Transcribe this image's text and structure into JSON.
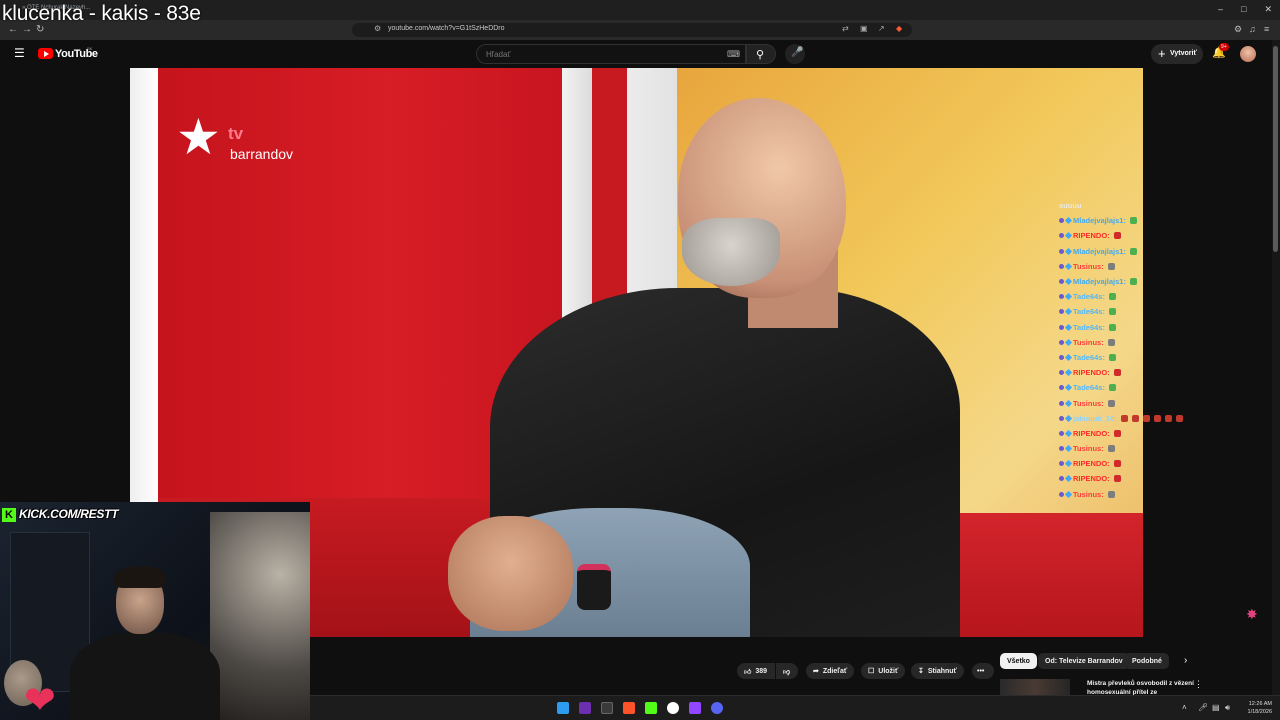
{
  "stream_overlay": {
    "title": "klucenka - kakis - 83e"
  },
  "browser": {
    "tab_title": "» OTE Nchurak Nazevh...",
    "url": "youtube.com/watch?v=G1tSzHeDDro",
    "window_controls": [
      "–",
      "□",
      "✕"
    ]
  },
  "youtube": {
    "logo_text": "YouTube",
    "region": "SK",
    "search_placeholder": "Hľadať",
    "create_label": "Vytvoriť",
    "notification_count": "9+"
  },
  "video": {
    "channel_logo_tv": "tv",
    "channel_logo_name": "barrandov"
  },
  "chat": [
    {
      "user": "xuuuu",
      "color": "#e8e8e8",
      "emote": ""
    },
    {
      "user": "Mladejvajlajs1:",
      "color": "#3fa9f5",
      "emote": "#4caf50"
    },
    {
      "user": "RIPENDO:",
      "color": "#ff2a2a",
      "emote": "#d12a2a"
    },
    {
      "user": "Mladejvajlajs1:",
      "color": "#3fa9f5",
      "emote": "#4caf50"
    },
    {
      "user": "Tusinus:",
      "color": "#ff3b3b",
      "emote": "#7d7d7d"
    },
    {
      "user": "Mladejvajlajs1:",
      "color": "#3fa9f5",
      "emote": "#4caf50"
    },
    {
      "user": "Tade64s:",
      "color": "#4fb8ff",
      "emote": "#4caf50"
    },
    {
      "user": "Tade64s:",
      "color": "#4fb8ff",
      "emote": "#4caf50"
    },
    {
      "user": "Tade64s:",
      "color": "#4fb8ff",
      "emote": "#4caf50"
    },
    {
      "user": "Tusinus:",
      "color": "#ff3b3b",
      "emote": "#7d7d7d"
    },
    {
      "user": "Tade64s:",
      "color": "#4fb8ff",
      "emote": "#4caf50"
    },
    {
      "user": "RIPENDO:",
      "color": "#ff2a2a",
      "emote": "#d12a2a"
    },
    {
      "user": "Tade64s:",
      "color": "#4fb8ff",
      "emote": "#4caf50"
    },
    {
      "user": "Tusinus:",
      "color": "#ff3b3b",
      "emote": "#7d7d7d"
    },
    {
      "user": "jakuuub_10:",
      "color": "#8fd3ff",
      "emote": "#c0392b"
    },
    {
      "user": "RIPENDO:",
      "color": "#ff2a2a",
      "emote": "#d12a2a"
    },
    {
      "user": "Tusinus:",
      "color": "#ff3b3b",
      "emote": "#7d7d7d"
    },
    {
      "user": "RIPENDO:",
      "color": "#ff2a2a",
      "emote": "#d12a2a"
    },
    {
      "user": "RIPENDO:",
      "color": "#ff2a2a",
      "emote": "#d12a2a"
    },
    {
      "user": "Tusinus:",
      "color": "#ff3b3b",
      "emote": "#7d7d7d"
    }
  ],
  "webcam": {
    "kick_label": "KICK.COM/RESTT",
    "kick_badge": "K"
  },
  "actions": {
    "like_count": "389",
    "share_label": "Zdieľať",
    "save_label": "Uložiť",
    "download_label": "Stiahnuť",
    "more_label": "•••"
  },
  "filter_chips": [
    "Všetko",
    "Od: Televize Barrandov",
    "Podobné"
  ],
  "recommendation": {
    "title": "Mistra převleků osvobodil z vězení homosexuální přítel ze"
  },
  "taskbar": {
    "clock_time": "12:26 AM",
    "clock_date": "1/18/2026"
  },
  "colors": {
    "accent": "#ff0000",
    "kick_green": "#53fc18",
    "background": "#0f0f0f"
  }
}
